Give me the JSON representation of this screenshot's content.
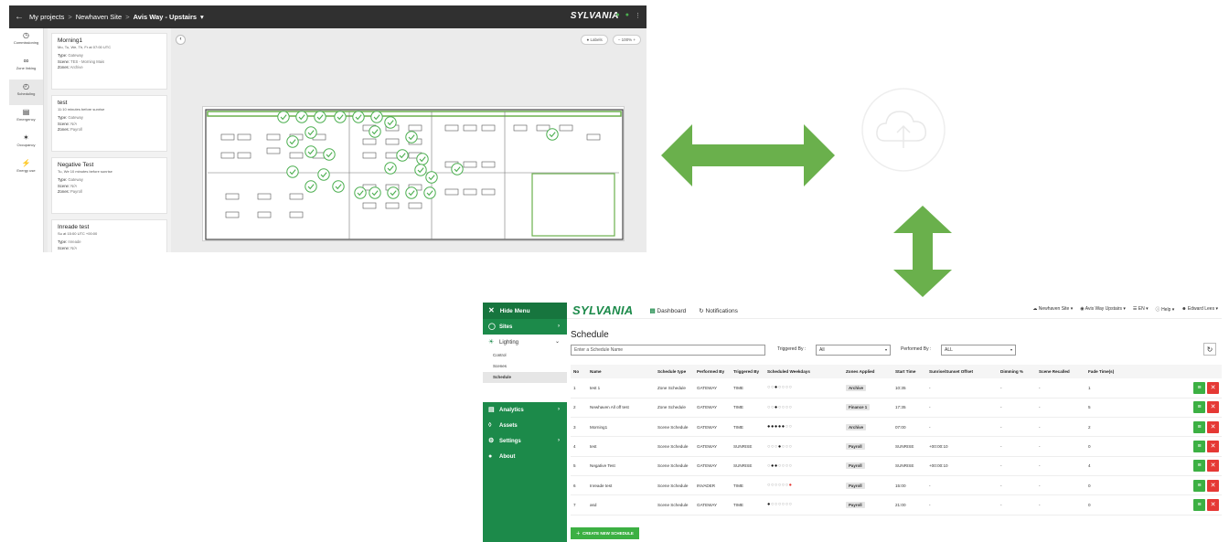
{
  "colors": {
    "arrow_green": "#6ab04c",
    "brand_green": "#1c8a4a",
    "topbar_dark": "#303030",
    "check_green": "#4caf50",
    "delete_red": "#e53935"
  },
  "portal": {
    "breadcrumb": [
      "My projects",
      "Newhaven Site",
      "Avis Way - Upstairs"
    ],
    "brand": "SYLVANIA",
    "nav": [
      {
        "icon": "gauge-icon",
        "label": "Commissioning"
      },
      {
        "icon": "link-icon",
        "label": "Zone linking"
      },
      {
        "icon": "clock-icon",
        "label": "Scheduling"
      },
      {
        "icon": "emergency-icon",
        "label": "Emergency"
      },
      {
        "icon": "person-icon",
        "label": "Occupancy"
      },
      {
        "icon": "bolt-icon",
        "label": "Energy use"
      }
    ],
    "cards": [
      {
        "title": "Morning1",
        "subtitle": "Mo, Tu, We, Th, Fr at 07:00 UTC",
        "rows": [
          [
            "Type:",
            "Gateway"
          ],
          [
            "Scene:",
            "TES - Morning Mais"
          ],
          [
            "Zones:",
            "Archive"
          ]
        ]
      },
      {
        "title": "test",
        "subtitle": "11:10 minutes before sunrise",
        "rows": [
          [
            "Type:",
            "Gateway"
          ],
          [
            "Scene:",
            "N/A"
          ],
          [
            "Zones:",
            "Payroll"
          ]
        ]
      },
      {
        "title": "Negative Test",
        "subtitle": "Tu, We 10 minutes before sunrise",
        "rows": [
          [
            "Type:",
            "Gateway"
          ],
          [
            "Scene:",
            "N/A"
          ],
          [
            "Zones:",
            "Payroll"
          ]
        ]
      },
      {
        "title": "Inreade test",
        "subtitle": "Su at 15:00 UTC +00:00",
        "rows": [
          [
            "Type:",
            "Inreade"
          ],
          [
            "Scene:",
            "N/A"
          ]
        ]
      }
    ],
    "toggle_label": "Labels",
    "zoom_label": "100%"
  },
  "dashboard": {
    "hide_menu": "Hide Menu",
    "brand": "SYLVANIA",
    "nav_dashboard": "Dashboard",
    "nav_notifications": "Notifications",
    "header_right": [
      "Newhaven Site ▾",
      "Avis Way Upstairs ▾",
      "EN ▾",
      "Help ▾",
      "Edward Lees ▾"
    ],
    "menu": [
      {
        "label": "Sites",
        "icon": "sites-icon"
      },
      {
        "label": "Lighting",
        "icon": "lighting-icon"
      },
      {
        "label": "Analytics",
        "icon": "analytics-icon"
      },
      {
        "label": "Assets",
        "icon": "assets-icon"
      },
      {
        "label": "Settings",
        "icon": "settings-icon"
      },
      {
        "label": "About",
        "icon": "info-icon"
      }
    ],
    "lighting_sub": [
      "Control",
      "Scenes",
      "Schedule"
    ],
    "page_title": "Schedule",
    "search_placeholder": "Enter a Schedule Name",
    "triggered_by_label": "Triggered By :",
    "triggered_by_value": "All",
    "performed_by_label": "Performed By :",
    "performed_by_value": "ALL",
    "columns": [
      "No",
      "Name",
      "Schedule type",
      "Performed By",
      "Triggered By",
      "Scheduled Weekdays",
      "Zones Applied",
      "Start Time",
      "Sunrise/Sunset Offset",
      "Dimming %",
      "Scene Recalled",
      "Fade Time(s)"
    ],
    "rows": [
      {
        "no": "1",
        "name": "test 1",
        "type": "Zone Schedule",
        "performed": "GATEWAY",
        "triggered": "TIME",
        "days": "0010000",
        "zone": "Archive",
        "start": "10:35",
        "offset": "-",
        "dimming": "-",
        "scene": "-",
        "fade": "1"
      },
      {
        "no": "2",
        "name": "Newhaven All off test",
        "type": "Zone Schedule",
        "performed": "GATEWAY",
        "triggered": "TIME",
        "days": "0010000",
        "zone": "Finance 1",
        "start": "17:35",
        "offset": "-",
        "dimming": "-",
        "scene": "-",
        "fade": "5"
      },
      {
        "no": "3",
        "name": "Morning1",
        "type": "Scene Schedule",
        "performed": "GATEWAY",
        "triggered": "TIME",
        "days": "1111100",
        "zone": "Archive",
        "start": "07:00",
        "offset": "-",
        "dimming": "-",
        "scene": "-",
        "fade": "2"
      },
      {
        "no": "4",
        "name": "test",
        "type": "Scene Schedule",
        "performed": "GATEWAY",
        "triggered": "SUNRISE",
        "days": "0001000",
        "zone": "Payroll",
        "start": "SUNRISE",
        "offset": "+00:00:10",
        "dimming": "-",
        "scene": "-",
        "fade": "0"
      },
      {
        "no": "5",
        "name": "Negative Test",
        "type": "Scene Schedule",
        "performed": "GATEWAY",
        "triggered": "SUNRISE",
        "days": "0110000",
        "zone": "Payroll",
        "start": "SUNRISE",
        "offset": "+00:00:10",
        "dimming": "-",
        "scene": "-",
        "fade": "4"
      },
      {
        "no": "6",
        "name": "Inreade test",
        "type": "Scene Schedule",
        "performed": "INVADER",
        "triggered": "TIME",
        "days": "000000r",
        "zone": "Payroll",
        "start": "15:00",
        "offset": "-",
        "dimming": "-",
        "scene": "-",
        "fade": "0"
      },
      {
        "no": "7",
        "name": "asd",
        "type": "Scene Schedule",
        "performed": "GATEWAY",
        "triggered": "TIME",
        "days": "1000000",
        "zone": "Payroll",
        "start": "21:00",
        "offset": "-",
        "dimming": "-",
        "scene": "-",
        "fade": "0"
      }
    ],
    "create_button": "CREATE NEW SCHEDULE"
  }
}
